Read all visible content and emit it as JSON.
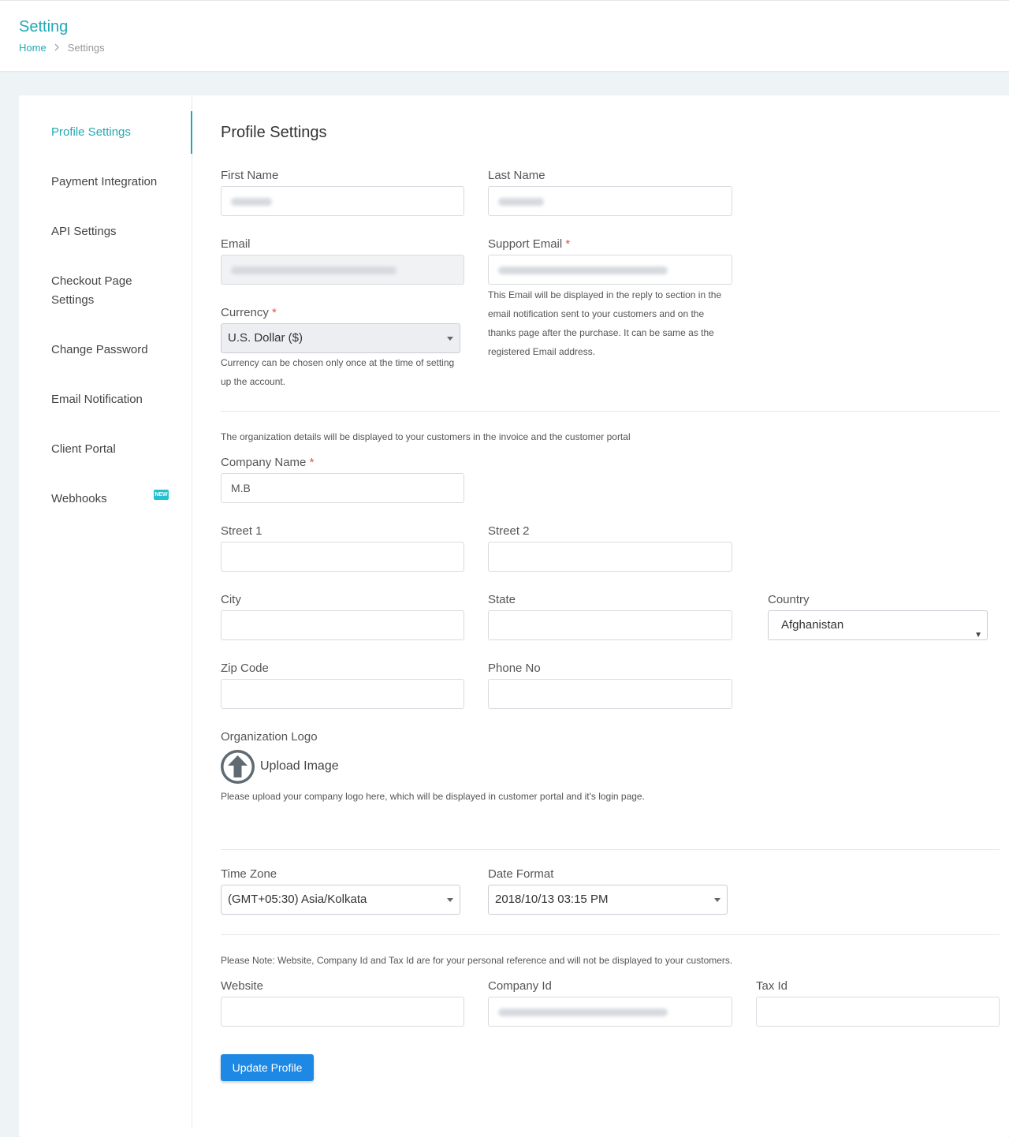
{
  "header": {
    "title": "Setting",
    "breadcrumb": {
      "home": "Home",
      "current": "Settings"
    }
  },
  "sidebar": {
    "items": [
      {
        "label": "Profile Settings",
        "active": true
      },
      {
        "label": "Payment Integration"
      },
      {
        "label": "API Settings"
      },
      {
        "label": "Checkout Page Settings"
      },
      {
        "label": "Change Password"
      },
      {
        "label": "Email Notification"
      },
      {
        "label": "Client Portal"
      },
      {
        "label": "Webhooks",
        "badge": "NEW"
      }
    ]
  },
  "form": {
    "title": "Profile Settings",
    "first_name": {
      "label": "First Name"
    },
    "last_name": {
      "label": "Last Name"
    },
    "email": {
      "label": "Email"
    },
    "support_email": {
      "label": "Support Email",
      "required": "*",
      "help": "This Email will be displayed in the reply to section in the email notification sent to your customers and on the thanks page after the purchase. It can be same as the registered Email address."
    },
    "currency": {
      "label": "Currency",
      "required": "*",
      "value": "U.S. Dollar ($)",
      "help": "Currency can be chosen only once at the time of setting up the account."
    },
    "org_note": "The organization details will be displayed to your customers in the invoice and the customer portal",
    "company_name": {
      "label": "Company Name",
      "required": "*",
      "value": "M.B"
    },
    "street1": {
      "label": "Street 1",
      "value": ""
    },
    "street2": {
      "label": "Street 2",
      "value": ""
    },
    "city": {
      "label": "City",
      "value": ""
    },
    "state": {
      "label": "State",
      "value": ""
    },
    "country": {
      "label": "Country",
      "value": "Afghanistan"
    },
    "zip": {
      "label": "Zip Code",
      "value": ""
    },
    "phone": {
      "label": "Phone No",
      "value": ""
    },
    "logo": {
      "label": "Organization Logo",
      "upload_label": "Upload Image",
      "help": "Please upload your company logo here, which will be displayed in customer portal and it's login page."
    },
    "time_zone": {
      "label": "Time Zone",
      "value": "(GMT+05:30) Asia/Kolkata"
    },
    "date_format": {
      "label": "Date Format",
      "value": "2018/10/13 03:15 PM"
    },
    "note": "Please Note: Website, Company Id and Tax Id are for your personal reference and will not be displayed to your customers.",
    "website": {
      "label": "Website",
      "value": ""
    },
    "company_id": {
      "label": "Company Id"
    },
    "tax_id": {
      "label": "Tax Id",
      "value": ""
    },
    "submit_label": "Update Profile"
  },
  "colors": {
    "accent": "#21a9b5",
    "button": "#1e88e5",
    "required": "#d9534f"
  },
  "icons": {
    "upload": "arrow-up-circle-icon",
    "breadcrumb_sep": "chevron-right-icon",
    "select": "caret-down-icon"
  }
}
